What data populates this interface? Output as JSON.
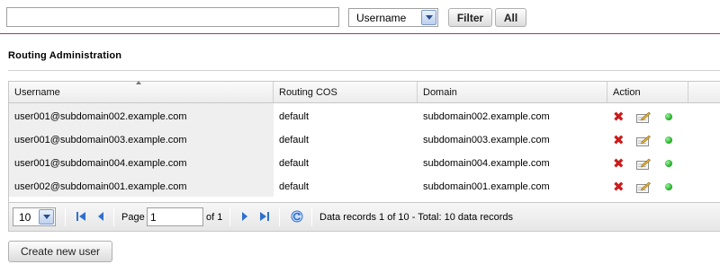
{
  "filter_bar": {
    "search_value": "",
    "field_selected": "Username",
    "filter_label": "Filter",
    "all_label": "All"
  },
  "page_title": "Routing Administration",
  "table": {
    "columns": [
      "Username",
      "Routing COS",
      "Domain",
      "Action"
    ],
    "sorted_column": "Username",
    "rows": [
      {
        "username": "user001@subdomain002.example.com",
        "cos": "default",
        "domain": "subdomain002.example.com",
        "status": "active"
      },
      {
        "username": "user001@subdomain003.example.com",
        "cos": "default",
        "domain": "subdomain003.example.com",
        "status": "active"
      },
      {
        "username": "user001@subdomain004.example.com",
        "cos": "default",
        "domain": "subdomain004.example.com",
        "status": "active"
      },
      {
        "username": "user002@subdomain001.example.com",
        "cos": "default",
        "domain": "subdomain001.example.com",
        "status": "active"
      }
    ],
    "action_icons": [
      "delete-icon",
      "edit-icon",
      "status-green-icon"
    ]
  },
  "pager": {
    "page_size": "10",
    "page_label": "Page",
    "page_value": "1",
    "of_label": "of 1",
    "summary": "Data records 1 of 10 - Total: 10 data records",
    "icons": [
      "first-page-icon",
      "prev-page-icon",
      "next-page-icon",
      "last-page-icon",
      "refresh-icon"
    ]
  },
  "create_button_label": "Create new user",
  "colors": {
    "accent_rule": "#9a3a6c",
    "delete": "#cc1b1b",
    "status_ok": "#17a81b",
    "nav_blue": "#2f6fd0"
  }
}
